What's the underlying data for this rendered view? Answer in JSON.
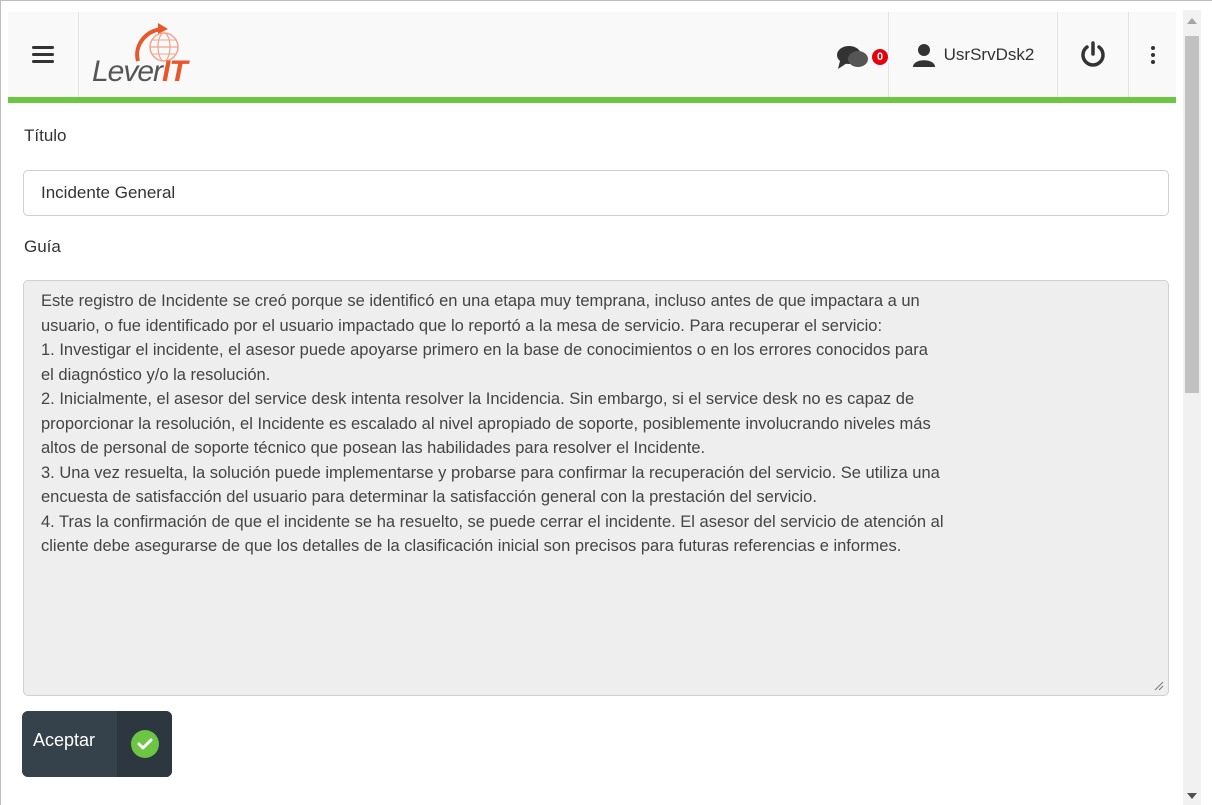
{
  "header": {
    "logo_text_main": "Lever",
    "logo_text_accent": "IT",
    "notifications_count": "0",
    "username": "UsrSrvDsk2"
  },
  "form": {
    "title_label": "Título",
    "title_value": "Incidente General",
    "guide_label": "Guía",
    "guide_lines": [
      "Este registro de Incidente se creó porque se identificó en una etapa muy temprana, incluso antes de que impactara a un",
      "usuario, o fue identificado por el usuario impactado que lo reportó a la mesa de servicio. Para recuperar el servicio:",
      "1. Investigar el incidente, el asesor puede apoyarse primero en la base de conocimientos o en los errores conocidos para",
      "el diagnóstico y/o la resolución.",
      "2. Inicialmente, el asesor del service desk intenta resolver la Incidencia. Sin embargo, si el service desk no es capaz de",
      "proporcionar la resolución, el Incidente es escalado al nivel apropiado de soporte, posiblemente involucrando niveles más",
      "altos de personal de soporte técnico que posean las habilidades para resolver el Incidente.",
      "3. Una vez resuelta, la solución puede implementarse y probarse para confirmar la recuperación del servicio. Se utiliza una",
      "encuesta de satisfacción del usuario para determinar la satisfacción general con la prestación del servicio.",
      "4. Tras la confirmación de que el incidente se ha resuelto, se puede cerrar el incidente. El asesor del servicio de atención al",
      "cliente debe asegurarse de que los detalles de la clasificación inicial son precisos para futuras referencias e informes."
    ],
    "accept_label": "Aceptar"
  },
  "icons": {
    "menu": "hamburger-menu-icon",
    "chat": "chat-bubbles-icon",
    "user": "user-icon",
    "power": "power-icon",
    "more": "vertical-dots-icon",
    "check": "check-circle-icon"
  },
  "colors": {
    "accent_green": "#6cc644",
    "button_dark": "#35424b",
    "badge_red": "#e8000b",
    "logo_orange": "#e8572a"
  }
}
